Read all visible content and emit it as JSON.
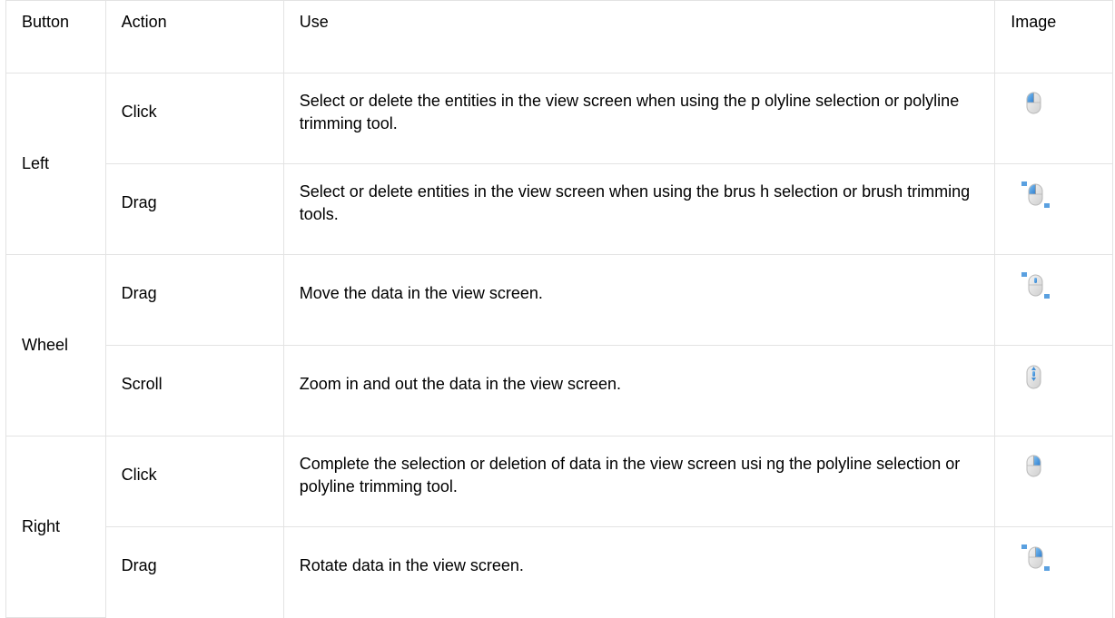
{
  "headers": {
    "button": "Button",
    "action": "Action",
    "use": "Use",
    "image": "Image"
  },
  "rows": [
    {
      "button": "Left",
      "action": "Click",
      "use": "Select or delete the entities in the view screen when using the p olyline selection or polyline trimming tool.",
      "icon": "mouse-left-click-icon"
    },
    {
      "action": "Drag",
      "use": "Select or delete entities in the view screen when using the brus h selection or brush trimming tools.",
      "icon": "mouse-left-drag-icon"
    },
    {
      "button": "Wheel",
      "action": "Drag",
      "use": "Move the data in the view screen.",
      "icon": "mouse-wheel-drag-icon"
    },
    {
      "action": "Scroll",
      "use": "Zoom in and out the data in the view screen.",
      "icon": "mouse-wheel-scroll-icon"
    },
    {
      "button": "Right",
      "action": "Click",
      "use": "Complete the selection or deletion of data in the view screen usi ng the polyline selection or polyline trimming tool.",
      "icon": "mouse-right-click-icon"
    },
    {
      "action": "Drag",
      "use": "Rotate data in the view screen.",
      "icon": "mouse-right-drag-icon"
    }
  ],
  "colors": {
    "border": "#e3e3e3",
    "icon_blue": "#3f8fd8",
    "icon_gray": "#c9c9c9"
  }
}
